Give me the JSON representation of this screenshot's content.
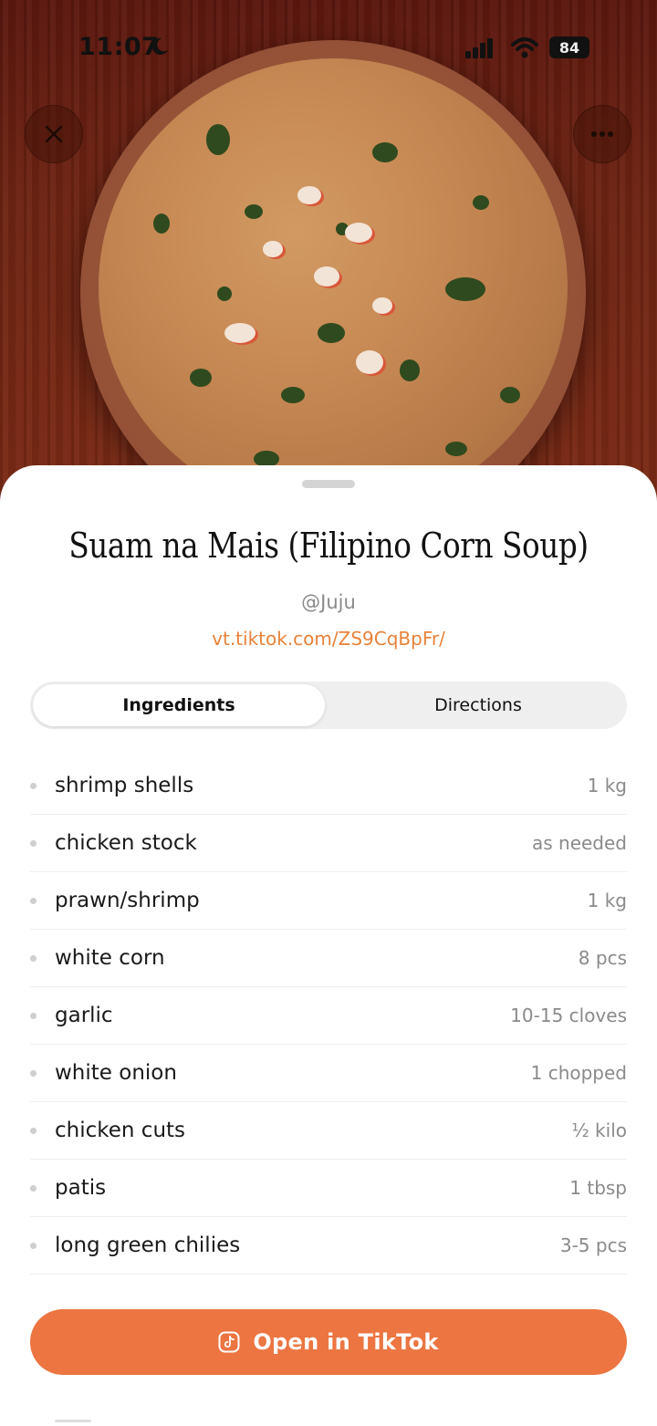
{
  "status_bar": {
    "time": "11:07",
    "battery": "84"
  },
  "recipe": {
    "title": "Suam na Mais (Filipino Corn Soup)",
    "author": "@Juju",
    "link": "vt.tiktok.com/ZS9CqBpFr/"
  },
  "tabs": [
    {
      "label": "Ingredients",
      "selected": true
    },
    {
      "label": "Directions",
      "selected": false
    }
  ],
  "ingredients": [
    {
      "name": "shrimp shells",
      "qty": "1 kg"
    },
    {
      "name": "chicken stock",
      "qty": "as needed"
    },
    {
      "name": "prawn/shrimp",
      "qty": "1 kg"
    },
    {
      "name": "white corn",
      "qty": "8 pcs"
    },
    {
      "name": "garlic",
      "qty": "10-15 cloves"
    },
    {
      "name": "white onion",
      "qty": "1 chopped"
    },
    {
      "name": "chicken cuts",
      "qty": "½ kilo"
    },
    {
      "name": "patis",
      "qty": "1 tbsp"
    },
    {
      "name": "long green chilies",
      "qty": "3-5 pcs"
    }
  ],
  "action": {
    "label": "Open in TikTok",
    "icon": "tiktok-icon",
    "color": "#ec7541"
  },
  "colors": {
    "accent_link": "#e8823a",
    "muted_text": "#8a8a8a"
  }
}
